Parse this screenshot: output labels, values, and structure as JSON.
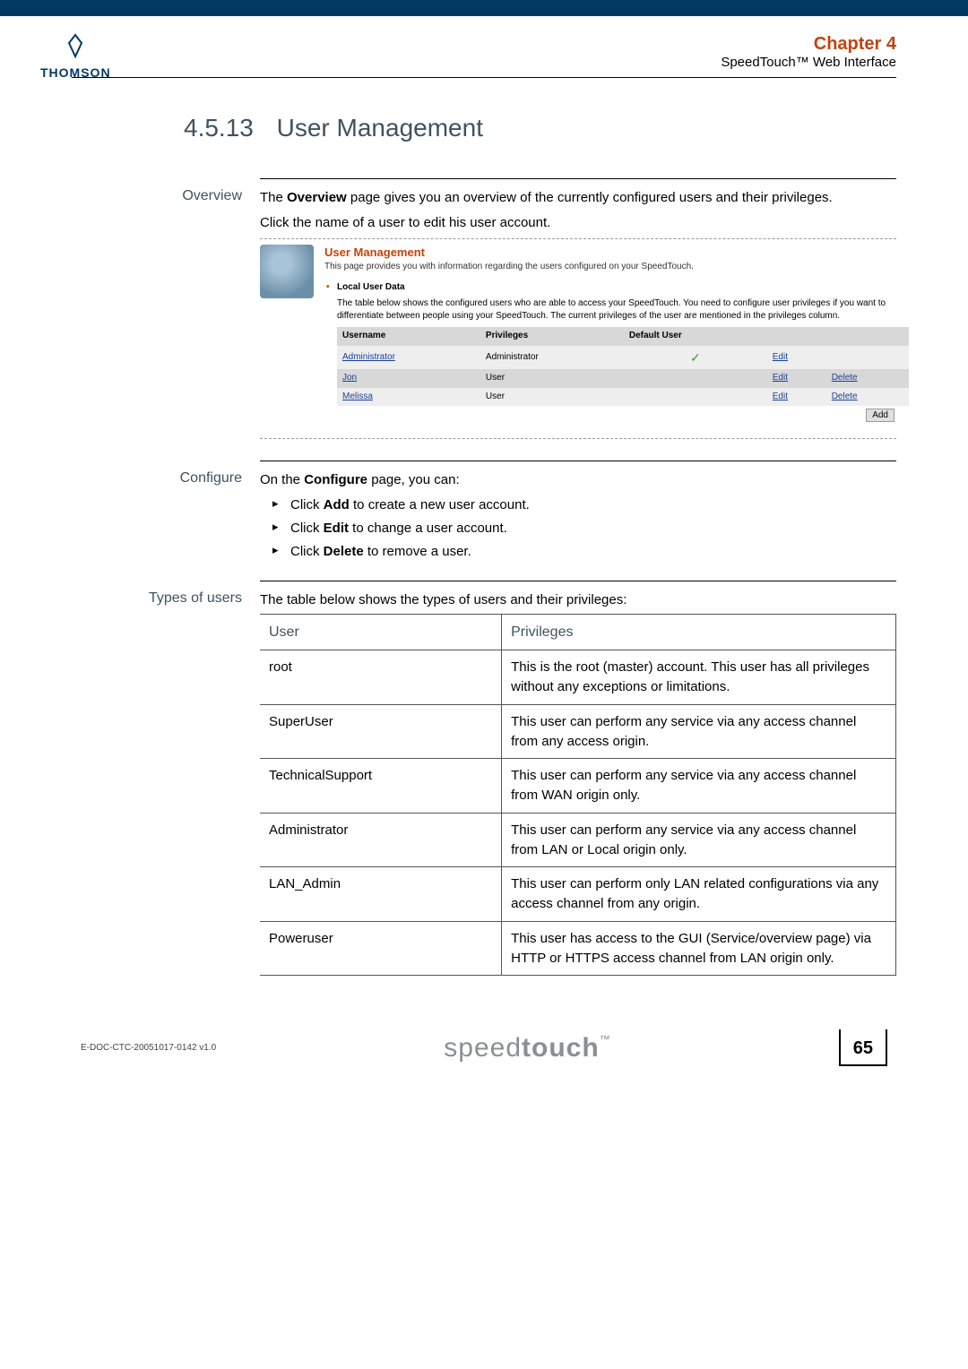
{
  "header": {
    "logo_text": "THOMSON",
    "chapter_label": "Chapter 4",
    "subtitle": "SpeedTouch™ Web Interface"
  },
  "section": {
    "number": "4.5.13",
    "title": "User Management"
  },
  "overview": {
    "label": "Overview",
    "para1_pre": "The ",
    "para1_bold": "Overview",
    "para1_post": " page gives you an overview of the currently configured users and their privileges.",
    "para2": "Click the name of a user to edit his user account."
  },
  "inset": {
    "title": "User Management",
    "subtitle": "This page provides you with information regarding the users configured on your SpeedTouch.",
    "bullet": "Local User Data",
    "desc": "The table below shows the configured users who are able to access your SpeedTouch. You need to configure user privileges if you want to differentiate between people using your SpeedTouch. The current privileges of the user are mentioned in the privileges column.",
    "cols": {
      "c1": "Username",
      "c2": "Privileges",
      "c3": "Default User"
    },
    "rows": [
      {
        "user": "Administrator",
        "priv": "Administrator",
        "default": true,
        "edit": "Edit",
        "del": ""
      },
      {
        "user": "Jon",
        "priv": "User",
        "default": false,
        "edit": "Edit",
        "del": "Delete"
      },
      {
        "user": "Melissa",
        "priv": "User",
        "default": false,
        "edit": "Edit",
        "del": "Delete"
      }
    ],
    "add": "Add"
  },
  "configure": {
    "label": "Configure",
    "intro_pre": "On the ",
    "intro_bold": "Configure",
    "intro_post": " page, you can:",
    "items": [
      {
        "pre": "Click ",
        "bold": "Add",
        "post": " to create a new user account."
      },
      {
        "pre": "Click ",
        "bold": "Edit",
        "post": " to change a user account."
      },
      {
        "pre": "Click ",
        "bold": "Delete",
        "post": " to remove a user."
      }
    ]
  },
  "types": {
    "label": "Types of users",
    "intro": "The table below shows the types of users and their privileges:",
    "head_user": "User",
    "head_priv": "Privileges",
    "rows": [
      {
        "user": "root",
        "priv": "This is the root (master) account. This user has all privileges without any exceptions or limitations."
      },
      {
        "user": "SuperUser",
        "priv": "This user can perform any service via any access channel from any access origin."
      },
      {
        "user": "TechnicalSupport",
        "priv": "This user can perform any service via any access channel from WAN origin only."
      },
      {
        "user": "Administrator",
        "priv": "This user can perform any service via any access channel from LAN or Local origin only."
      },
      {
        "user": "LAN_Admin",
        "priv": "This user can perform only LAN related configurations via any access channel from any origin."
      },
      {
        "user": "Poweruser",
        "priv": "This user has access to the GUI (Service/overview page) via HTTP or HTTPS access channel from LAN origin only."
      }
    ]
  },
  "footer": {
    "doc_id": "E-DOC-CTC-20051017-0142 v1.0",
    "brand_light": "speed",
    "brand_bold": "touch",
    "page": "65"
  }
}
